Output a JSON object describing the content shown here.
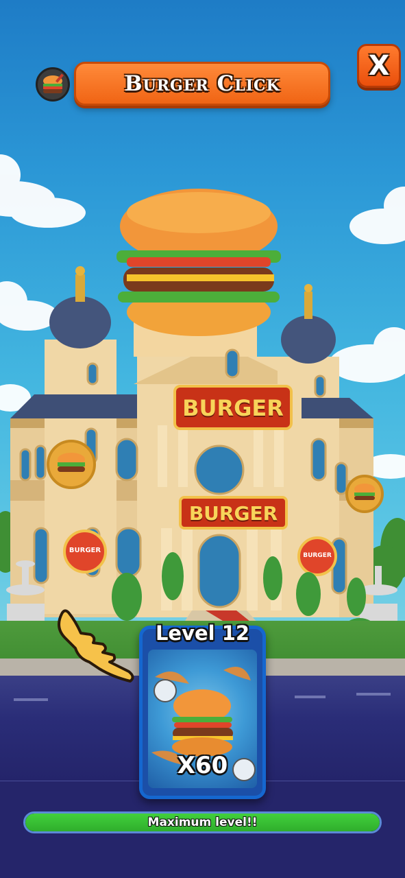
{
  "header": {
    "title": "Burger Click",
    "close_label": "X",
    "icon": "burger-icon"
  },
  "scene": {
    "building_signs": [
      "BURGER",
      "BURGER"
    ],
    "small_sign_labels": [
      "BURGER",
      "BURGER"
    ],
    "pointer_icon": "pointing-hand-icon"
  },
  "card": {
    "level_label": "Level 12",
    "multiplier_label": "X60",
    "art_icon": "speed-burger-icon"
  },
  "progress": {
    "label": "Maximum level!!",
    "fraction": 1.0
  },
  "colors": {
    "title_bg": "#f06414",
    "close_bg": "#ea4f0c",
    "card_border": "#1567cf",
    "progress_fill": "#2fae2c",
    "background": "#25256a"
  }
}
